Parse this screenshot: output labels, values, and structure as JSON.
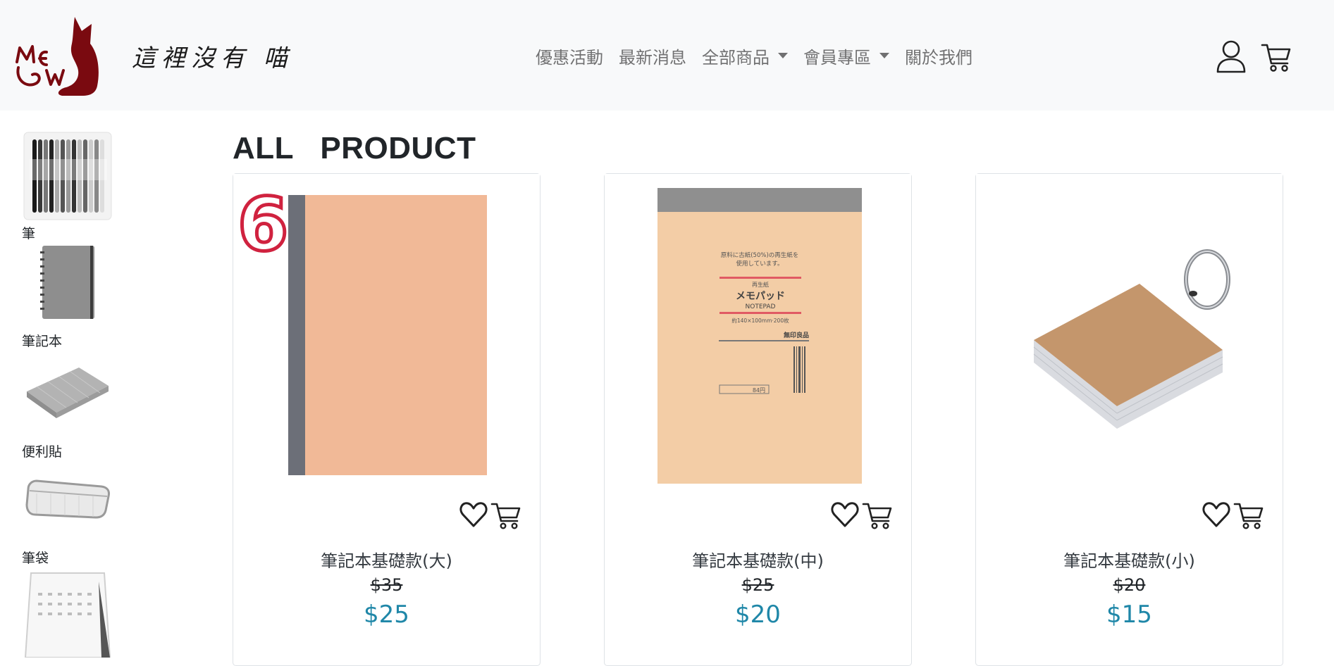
{
  "brand": {
    "name": "這裡沒有 喵",
    "logo_icon": "mew-cat-logo",
    "color": "#7a0a10"
  },
  "nav": {
    "items": [
      {
        "label": "優惠活動",
        "dropdown": false
      },
      {
        "label": "最新消息",
        "dropdown": false
      },
      {
        "label": "全部商品",
        "dropdown": true
      },
      {
        "label": "會員專區",
        "dropdown": true
      },
      {
        "label": "關於我們",
        "dropdown": false
      }
    ],
    "icons": [
      "user-icon",
      "cart-icon"
    ]
  },
  "sidebar": {
    "categories": [
      {
        "label": "筆",
        "icon": "pens-thumbnail"
      },
      {
        "label": "筆記本",
        "icon": "notebook-thumbnail"
      },
      {
        "label": "便利貼",
        "icon": "sticky-notes-thumbnail"
      },
      {
        "label": "筆袋",
        "icon": "pencil-case-thumbnail"
      },
      {
        "label": "",
        "icon": "calendar-thumbnail"
      }
    ]
  },
  "main": {
    "title": "ALL   PRODUCT",
    "products": [
      {
        "name": "筆記本基礎款(大)",
        "old_price": "$35",
        "price": "$25",
        "image": "notebook-large-image",
        "badge": "6"
      },
      {
        "name": "筆記本基礎款(中)",
        "old_price": "$25",
        "price": "$20",
        "image": "notepad-medium-image"
      },
      {
        "name": "筆記本基礎款(小)",
        "old_price": "$20",
        "price": "$15",
        "image": "ring-cards-small-image"
      }
    ]
  },
  "notepad_image_text": {
    "line1": "原料に古紙(50%)の再生紙を",
    "line2": "使用しています。",
    "tag": "再生紙",
    "title": "メモパッド",
    "subtitle": "NOTEPAD",
    "size": "約140×100mm·200枚",
    "maker": "無印良品",
    "price": "84円"
  },
  "colors": {
    "price_accent": "#1f87a8",
    "navbar_bg": "#f8f9fa",
    "badge_red": "#d0223f"
  }
}
